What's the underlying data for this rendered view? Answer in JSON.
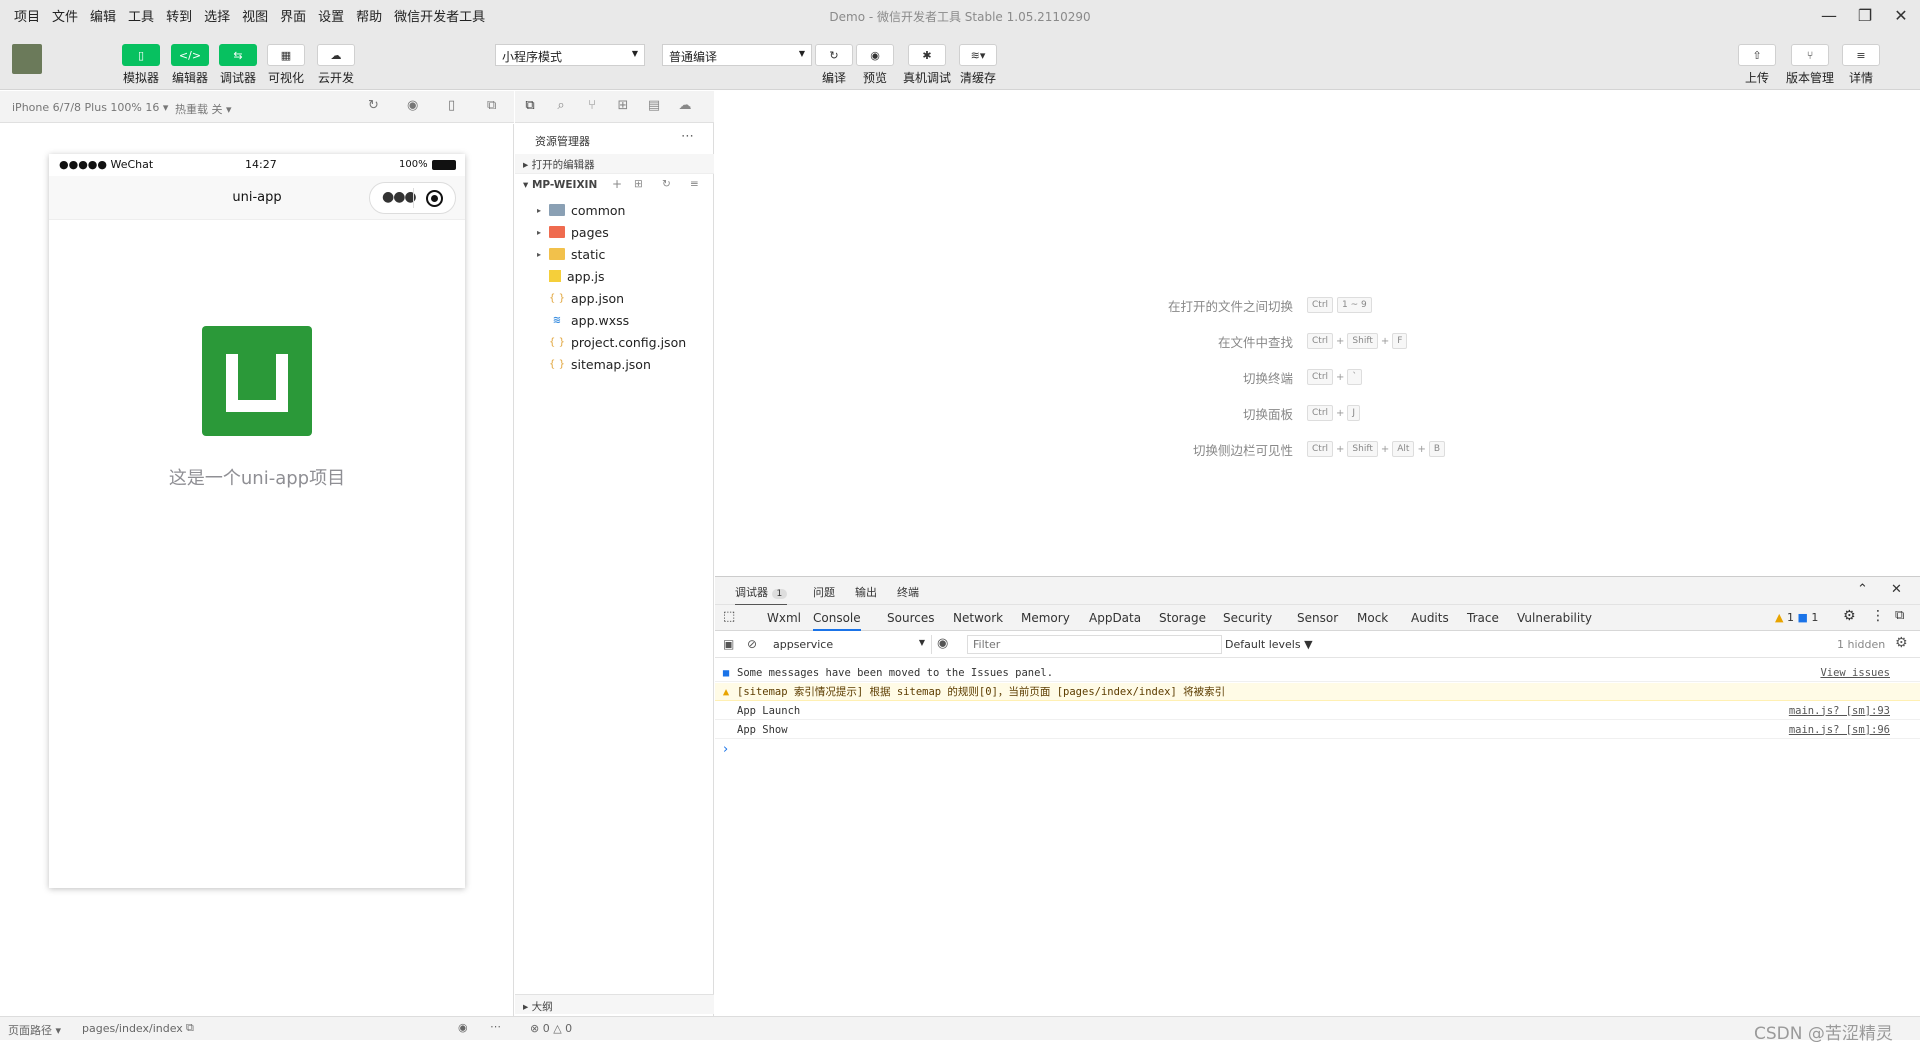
{
  "menubar": {
    "items": [
      "项目",
      "文件",
      "编辑",
      "工具",
      "转到",
      "选择",
      "视图",
      "界面",
      "设置",
      "帮助",
      "微信开发者工具"
    ],
    "window_title": "Demo - 微信开发者工具 Stable 1.05.2110290"
  },
  "toolbar": {
    "simulator": "模拟器",
    "editor": "编辑器",
    "debugger": "调试器",
    "visual": "可视化",
    "cloud": "云开发",
    "mode_select": "小程序模式",
    "compile_select": "普通编译",
    "compile": "编译",
    "preview": "预览",
    "remote_debug": "真机调试",
    "clear_cache": "清缓存",
    "upload": "上传",
    "version": "版本管理",
    "details": "详情"
  },
  "simulator": {
    "device": "iPhone 6/7/8 Plus 100% 16",
    "hot_reload": "热重载 关",
    "carrier": "●●●●● WeChat",
    "time": "14:27",
    "battery": "100%",
    "nav_title": "uni-app",
    "logo_letter": "U",
    "content_text": "这是一个uni-app项目"
  },
  "explorer": {
    "title": "资源管理器",
    "open_editors": "打开的编辑器",
    "project": "MP-WEIXIN",
    "files": [
      {
        "name": "common",
        "type": "folder"
      },
      {
        "name": "pages",
        "type": "folder"
      },
      {
        "name": "static",
        "type": "folder"
      },
      {
        "name": "app.js",
        "type": "js"
      },
      {
        "name": "app.json",
        "type": "json"
      },
      {
        "name": "app.wxss",
        "type": "wxss"
      },
      {
        "name": "project.config.json",
        "type": "json"
      },
      {
        "name": "sitemap.json",
        "type": "json"
      }
    ],
    "outline": "大纲"
  },
  "editor_hints": [
    {
      "label": "在打开的文件之间切换",
      "keys": [
        "Ctrl",
        "1 ~ 9"
      ]
    },
    {
      "label": "在文件中查找",
      "keys": [
        "Ctrl",
        "Shift",
        "F"
      ]
    },
    {
      "label": "切换终端",
      "keys": [
        "Ctrl",
        "`"
      ]
    },
    {
      "label": "切换面板",
      "keys": [
        "Ctrl",
        "J"
      ]
    },
    {
      "label": "切换侧边栏可见性",
      "keys": [
        "Ctrl",
        "Shift",
        "Alt",
        "B"
      ]
    }
  ],
  "devtools": {
    "top_tabs": [
      "调试器",
      "问题",
      "输出",
      "终端"
    ],
    "debugger_badge": "1",
    "tabs": [
      "Wxml",
      "Console",
      "Sources",
      "Network",
      "Memory",
      "AppData",
      "Storage",
      "Security",
      "Sensor",
      "Mock",
      "Audits",
      "Trace",
      "Vulnerability"
    ],
    "warn_count": "1",
    "info_count": "1",
    "context": "appservice",
    "filter_placeholder": "Filter",
    "levels": "Default levels ▼",
    "hidden": "1 hidden",
    "logs": [
      {
        "type": "info",
        "text": "Some messages have been moved to the Issues panel.",
        "src": "View issues"
      },
      {
        "type": "warn",
        "text": "[sitemap 索引情况提示] 根据 sitemap 的规则[0]，当前页面 [pages/index/index] 将被索引",
        "src": ""
      },
      {
        "type": "log",
        "text": "App Launch",
        "src": "main.js? [sm]:93"
      },
      {
        "type": "log",
        "text": "App Show",
        "src": "main.js? [sm]:96"
      }
    ],
    "prompt": "›"
  },
  "statusbar": {
    "page_path_label": "页面路径 ▾",
    "page_path": "pages/index/index",
    "errors": "⊗ 0 △ 0",
    "watermark": "CSDN @苦涩精灵"
  },
  "colors": {
    "accent_green": "#07c160",
    "uni_green": "#2b9939",
    "warn_bg": "#fffbe6"
  }
}
